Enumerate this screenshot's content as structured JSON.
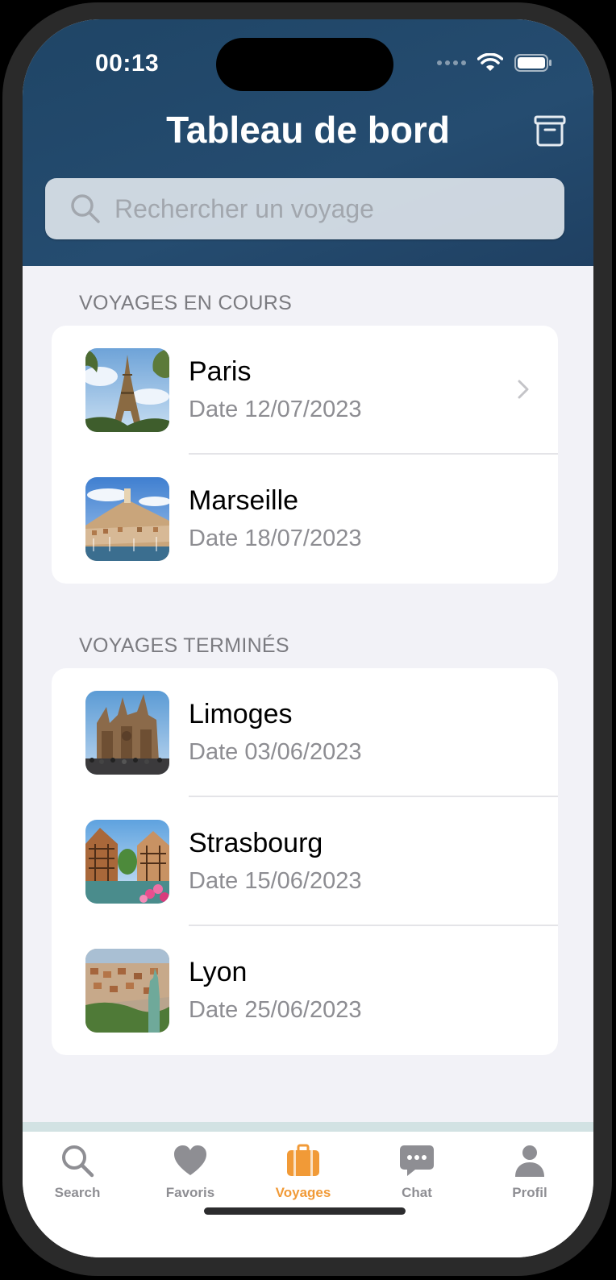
{
  "status_bar": {
    "time": "00:13"
  },
  "header": {
    "title": "Tableau de bord",
    "archive_icon": "archive-box-icon",
    "search_placeholder": "Rechercher un voyage"
  },
  "sections": [
    {
      "title": "VOYAGES EN COURS",
      "trips": [
        {
          "name": "Paris",
          "date": "Date 12/07/2023",
          "image": "eiffel-tower-photo",
          "has_chevron": true
        },
        {
          "name": "Marseille",
          "date": "Date 18/07/2023",
          "image": "marseille-port-photo",
          "has_chevron": false
        }
      ]
    },
    {
      "title": "VOYAGES TERMINÉS",
      "trips": [
        {
          "name": "Limoges",
          "date": "Date 03/06/2023",
          "image": "cathedral-photo"
        },
        {
          "name": "Strasbourg",
          "date": "Date 15/06/2023",
          "image": "petite-france-photo"
        },
        {
          "name": "Lyon",
          "date": "Date 25/06/2023",
          "image": "lyon-city-photo"
        }
      ]
    }
  ],
  "tabbar": {
    "active": "Voyages",
    "accent_color": "#f19a37",
    "inactive_color": "#8e8e93",
    "tabs": [
      {
        "label": "Search",
        "icon": "magnifier-icon"
      },
      {
        "label": "Favoris",
        "icon": "heart-icon"
      },
      {
        "label": "Voyages",
        "icon": "suitcase-icon"
      },
      {
        "label": "Chat",
        "icon": "chat-bubble-icon"
      },
      {
        "label": "Profil",
        "icon": "person-icon"
      }
    ]
  }
}
